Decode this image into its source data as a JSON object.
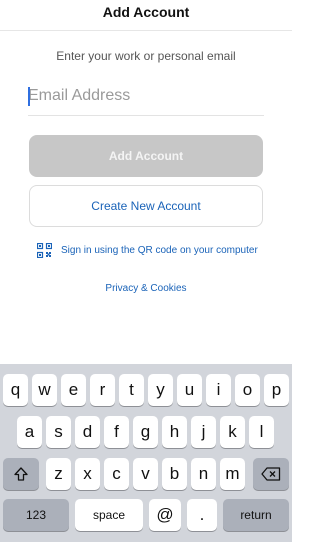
{
  "header": {
    "title": "Add Account"
  },
  "form": {
    "subtitle": "Enter your work or personal email",
    "email_placeholder": "Email Address",
    "email_value": "",
    "add_button": "Add Account",
    "create_button": "Create New Account",
    "qr_link": "Sign in using the QR code on your computer",
    "privacy_link": "Privacy & Cookies"
  },
  "keyboard": {
    "row1": [
      "q",
      "w",
      "e",
      "r",
      "t",
      "y",
      "u",
      "i",
      "o",
      "p"
    ],
    "row2": [
      "a",
      "s",
      "d",
      "f",
      "g",
      "h",
      "j",
      "k",
      "l"
    ],
    "row3": [
      "z",
      "x",
      "c",
      "v",
      "b",
      "n",
      "m"
    ],
    "numbers_key": "123",
    "space_key": "space",
    "at_key": "@",
    "dot_key": ".",
    "return_key": "return",
    "shift_icon": "shift-icon",
    "backspace_icon": "backspace-icon"
  },
  "colors": {
    "accent": "#1a63b8",
    "disabled_button": "#c7c7c7",
    "keyboard_bg": "#d2d5db"
  }
}
